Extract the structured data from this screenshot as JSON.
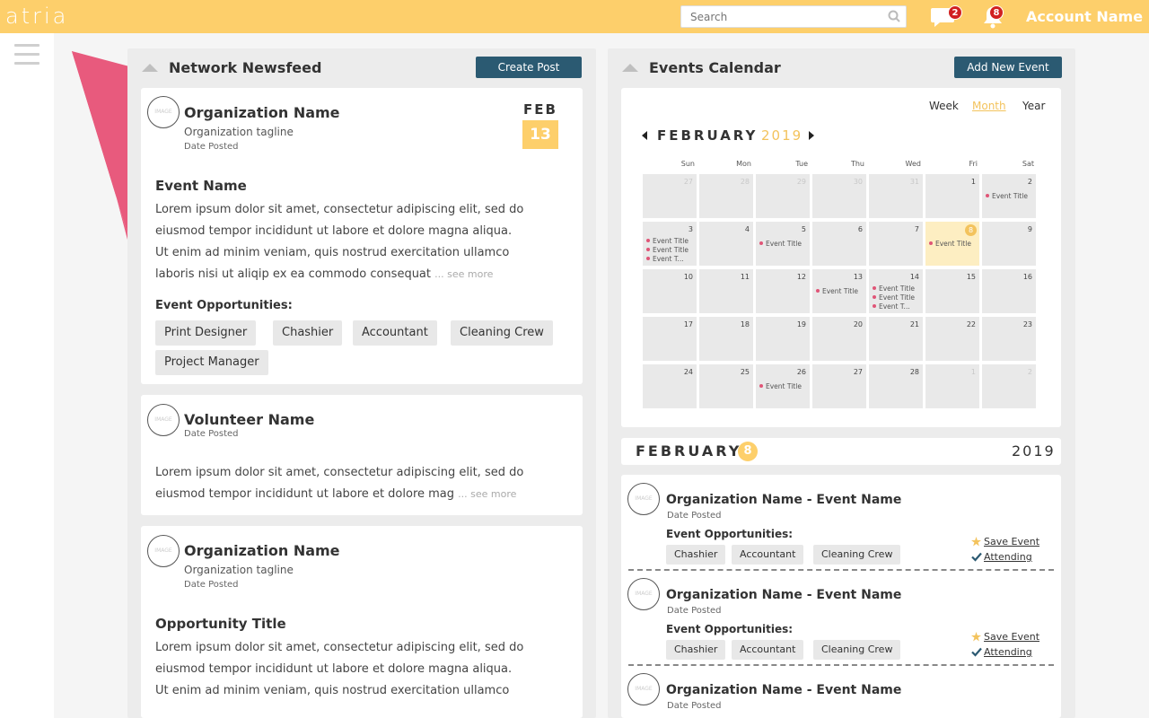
{
  "header": {
    "logo": "atria",
    "search_placeholder": "Search",
    "messages_count": "2",
    "notifications_count": "8",
    "account_name": "Account Name"
  },
  "colors": {
    "brand": "#fdcf6b",
    "accent_dark": "#2b5a72",
    "pink": "#e85a7d",
    "gold": "#f3c35d"
  },
  "newsfeed": {
    "title": "Network Newsfeed",
    "create_button": "Create Post",
    "posts": [
      {
        "name": "Organization Name",
        "tagline": "Organization tagline",
        "date_posted": "Date Posted",
        "date_month": "FEB",
        "date_day": "13",
        "title": "Event Name",
        "body": [
          "Lorem ipsum dolor sit amet, consectetur adipiscing elit, sed do",
          "eiusmod tempor incididunt ut labore et dolore magna aliqua.",
          "Ut enim ad minim veniam, quis nostrud exercitation ullamco",
          "laboris nisi ut aliqip ex ea commodo consequat"
        ],
        "see_more": "... see more",
        "opportunities_label": "Event Opportunities:",
        "opportunities": [
          "Print Designer",
          "Chashier",
          "Accountant",
          "Cleaning Crew",
          "Project Manager"
        ]
      },
      {
        "name": "Volunteer Name",
        "date_posted": "Date Posted",
        "body": [
          "Lorem ipsum dolor sit amet, consectetur adipiscing elit, sed do",
          "eiusmod tempor incididunt ut labore et dolore mag"
        ],
        "see_more": "... see more"
      },
      {
        "name": "Organization Name",
        "tagline": "Organization tagline",
        "date_posted": "Date Posted",
        "title": "Opportunity Title",
        "body": [
          "Lorem ipsum dolor sit amet, consectetur adipiscing elit, sed do",
          "eiusmod tempor incididunt ut labore et dolore magna aliqua.",
          "Ut enim ad minim veniam, quis nostrud exercitation ullamco"
        ]
      }
    ]
  },
  "calendar": {
    "title": "Events Calendar",
    "add_button": "Add New Event",
    "views": [
      "Week",
      "Month",
      "Year"
    ],
    "active_view": "Month",
    "month": "FEBRUARY",
    "year": "2019",
    "weekdays": [
      "Sun",
      "Mon",
      "Tue",
      "Thu",
      "Wed",
      "Fri",
      "Sat"
    ],
    "weeks": [
      [
        {
          "d": "27",
          "m": true
        },
        {
          "d": "28",
          "m": true
        },
        {
          "d": "29",
          "m": true
        },
        {
          "d": "30",
          "m": true
        },
        {
          "d": "31",
          "m": true
        },
        {
          "d": "1"
        },
        {
          "d": "2",
          "ev": [
            "Event Title"
          ]
        }
      ],
      [
        {
          "d": "3",
          "ev": [
            "Event Title",
            "Event Title",
            "Event T..."
          ]
        },
        {
          "d": "4"
        },
        {
          "d": "5",
          "ev": [
            "Event Title"
          ]
        },
        {
          "d": "6"
        },
        {
          "d": "7"
        },
        {
          "d": "8",
          "today": true,
          "ev": [
            "Event Title"
          ]
        },
        {
          "d": "9"
        }
      ],
      [
        {
          "d": "10"
        },
        {
          "d": "11"
        },
        {
          "d": "12"
        },
        {
          "d": "13",
          "ev": [
            "Event Title"
          ]
        },
        {
          "d": "14",
          "ev": [
            "Event Title",
            "Event Title",
            "Event T..."
          ]
        },
        {
          "d": "15"
        },
        {
          "d": "16"
        }
      ],
      [
        {
          "d": "17"
        },
        {
          "d": "18"
        },
        {
          "d": "19"
        },
        {
          "d": "20"
        },
        {
          "d": "21"
        },
        {
          "d": "22"
        },
        {
          "d": "23"
        }
      ],
      [
        {
          "d": "24"
        },
        {
          "d": "25"
        },
        {
          "d": "26",
          "ev": [
            "Event Title"
          ]
        },
        {
          "d": "27"
        },
        {
          "d": "28"
        },
        {
          "d": "1",
          "m": true
        },
        {
          "d": "2",
          "m": true
        }
      ]
    ]
  },
  "selected_day": {
    "month": "FEBRUARY",
    "day": "8",
    "year": "2019",
    "events": [
      {
        "title": "Organization Name - Event Name",
        "date_posted": "Date Posted",
        "opportunities_label": "Event Opportunities:",
        "opportunities": [
          "Chashier",
          "Accountant",
          "Cleaning Crew"
        ],
        "save_label": "Save Event",
        "attending_label": "Attending"
      },
      {
        "title": "Organization Name - Event Name",
        "date_posted": "Date Posted",
        "opportunities_label": "Event Opportunities:",
        "opportunities": [
          "Chashier",
          "Accountant",
          "Cleaning Crew"
        ],
        "save_label": "Save Event",
        "attending_label": "Attending"
      },
      {
        "title": "Organization Name - Event Name",
        "date_posted": "Date Posted"
      }
    ]
  }
}
